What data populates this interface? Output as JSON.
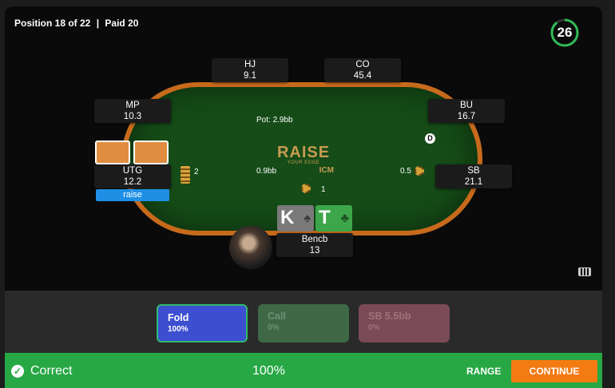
{
  "header": {
    "position": "Position 18 of 22",
    "separator": "|",
    "paid": "Paid 20",
    "timer": "26"
  },
  "seats": {
    "hj": {
      "name": "HJ",
      "stack": "9.1"
    },
    "co": {
      "name": "CO",
      "stack": "45.4"
    },
    "mp": {
      "name": "MP",
      "stack": "10.3"
    },
    "bu": {
      "name": "BU",
      "stack": "16.7"
    },
    "utg": {
      "name": "UTG",
      "stack": "12.2",
      "action": "raise",
      "bet": "2"
    },
    "sb": {
      "name": "SB",
      "stack": "21.1",
      "bet": "0.5"
    },
    "hero": {
      "name": "Bencb",
      "stack": "13",
      "bet": "1"
    }
  },
  "table": {
    "pot": "Pot: 2.9bb",
    "center_bet": "0.9bb",
    "dealer": "D",
    "logo": {
      "main": "RAISE",
      "sub": "YOUR EDGE",
      "icm": "ICM"
    }
  },
  "hero_cards": [
    {
      "rank": "K",
      "suit": "♠",
      "color": "#7a7a7a"
    },
    {
      "rank": "T",
      "suit": "♣",
      "color": "#3ea64a"
    }
  ],
  "actions": {
    "fold": {
      "label": "Fold",
      "pct": "100%"
    },
    "call": {
      "label": "Call",
      "pct": "0%"
    },
    "raise": {
      "label": "SB 5.5bb",
      "pct": "0%"
    }
  },
  "result": {
    "label": "Correct",
    "pct": "100%",
    "range": "RANGE",
    "continue": "CONTINUE"
  },
  "colors": {
    "felt": "#154c17",
    "rail": "#c76a1c",
    "fold": "#3d4fd1",
    "correct": "#27a845",
    "continue": "#f47a12"
  }
}
